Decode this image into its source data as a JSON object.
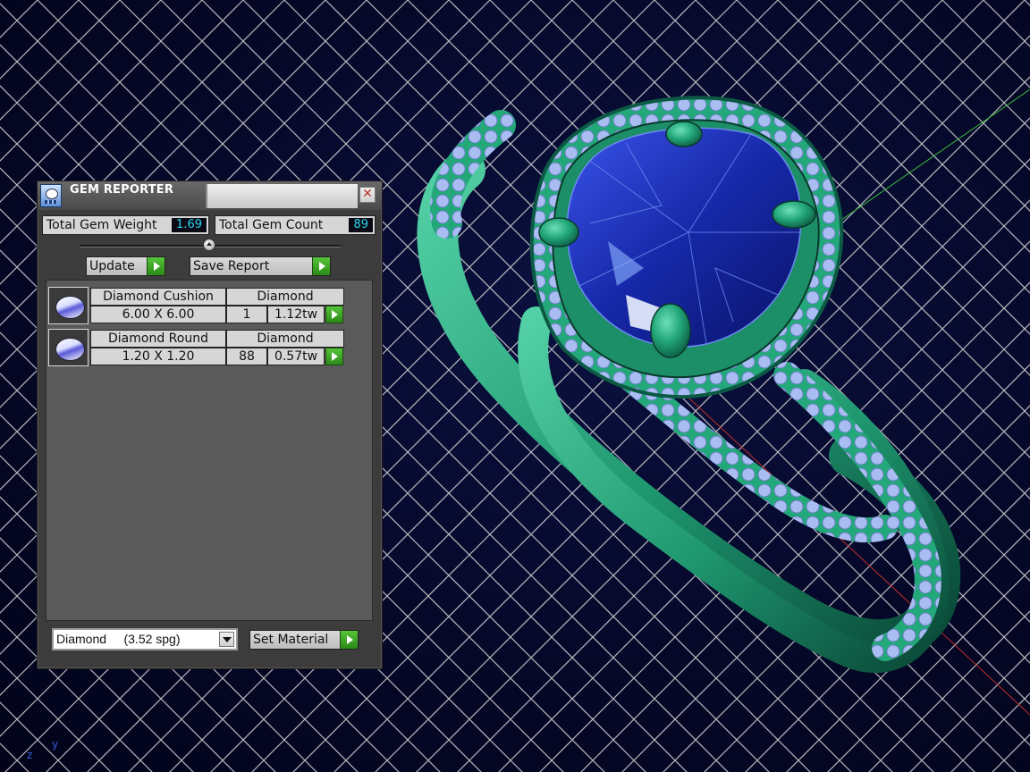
{
  "panel": {
    "title": "GEM REPORTER",
    "summary": {
      "weight_label": "Total Gem Weight",
      "weight_value": "1.69",
      "count_label": "Total Gem Count",
      "count_value": "89"
    },
    "update_label": "Update",
    "save_report_label": "Save Report",
    "gems": [
      {
        "name": "Diamond Cushion",
        "material": "Diamond",
        "size": "6.00 X 6.00",
        "count": "1",
        "weight": "1.12tw"
      },
      {
        "name": "Diamond Round",
        "material": "Diamond",
        "size": "1.20 X 1.20",
        "count": "88",
        "weight": "0.57tw"
      }
    ],
    "material_select": "Diamond     (3.52 spg)",
    "set_material_label": "Set Material"
  },
  "axis_labels": {
    "z": "z",
    "y": "y"
  },
  "colors": {
    "ring_metal": "#23a87a",
    "center_stone": "#1f2fb8",
    "pave_stones": "#a9bdf2",
    "grid": "#d7d7d7",
    "value_text": "#2ad4f0",
    "button_green": "#3fae26"
  }
}
